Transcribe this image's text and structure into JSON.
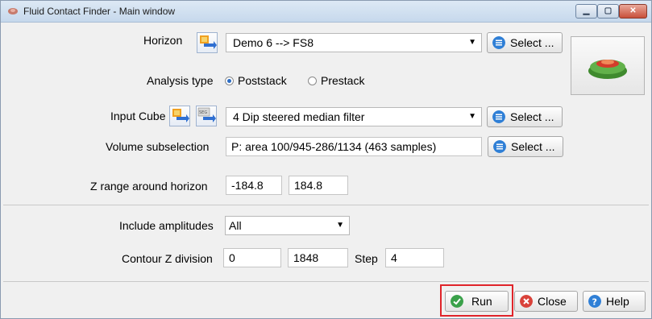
{
  "window": {
    "title": "Fluid Contact Finder - Main window"
  },
  "horizon": {
    "label": "Horizon",
    "value": "Demo 6 --> FS8",
    "select_label": "Select ..."
  },
  "analysis": {
    "label": "Analysis type",
    "options": [
      "Poststack",
      "Prestack"
    ],
    "selected": "Poststack"
  },
  "input_cube": {
    "label": "Input Cube",
    "value": "4 Dip steered median filter",
    "select_label": "Select ..."
  },
  "volume": {
    "label": "Volume subselection",
    "value": "P: area 100/945-286/1134 (463 samples)",
    "select_label": "Select ..."
  },
  "z_range": {
    "label": "Z range around horizon",
    "min": "-184.8",
    "max": "184.8"
  },
  "amplitudes": {
    "label": "Include amplitudes",
    "value": "All"
  },
  "contour": {
    "label": "Contour Z division",
    "start": "0",
    "stop": "1848",
    "step_label": "Step",
    "step": "4"
  },
  "footer": {
    "run": "Run",
    "close": "Close",
    "help": "Help"
  },
  "colors": {
    "accent_blue": "#2f7fd6",
    "run_green": "#3aa14a",
    "close_red": "#d9423a",
    "highlight_red": "#e0242a"
  }
}
